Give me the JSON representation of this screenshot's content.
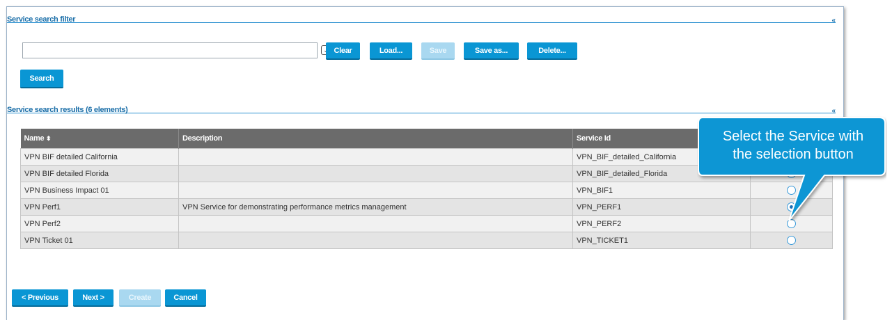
{
  "filter": {
    "section_title": "Service search filter",
    "collapse_label": "«",
    "input_value": "",
    "buttons": {
      "clear": "Clear",
      "load": "Load...",
      "save": "Save",
      "save_as": "Save as...",
      "delete": "Delete...",
      "search": "Search"
    }
  },
  "results": {
    "section_title": "Service search results (6 elements)",
    "collapse_label": "«",
    "columns": [
      "Name",
      "Description",
      "Service Id"
    ],
    "sort_indicator": "⬍",
    "rows": [
      {
        "name": "VPN BIF detailed California",
        "description": "",
        "service_id": "VPN_BIF_detailed_California",
        "selected": false
      },
      {
        "name": "VPN BIF detailed Florida",
        "description": "",
        "service_id": "VPN_BIF_detailed_Florida",
        "selected": false
      },
      {
        "name": "VPN Business Impact 01",
        "description": "",
        "service_id": "VPN_BIF1",
        "selected": false
      },
      {
        "name": "VPN Perf1",
        "description": "VPN Service for demonstrating performance metrics management",
        "service_id": "VPN_PERF1",
        "selected": true
      },
      {
        "name": "VPN Perf2",
        "description": "",
        "service_id": "VPN_PERF2",
        "selected": false
      },
      {
        "name": "VPN Ticket 01",
        "description": "",
        "service_id": "VPN_TICKET1",
        "selected": false
      }
    ]
  },
  "footer": {
    "previous": "< Previous",
    "next": "Next >",
    "create": "Create",
    "cancel": "Cancel"
  },
  "callout": {
    "line1": "Select the Service with",
    "line2": "the selection button"
  },
  "colors": {
    "accent": "#0a96d4",
    "header_text": "#1a6ea8",
    "table_header": "#6b6b6b",
    "callout": "#0a96d4"
  }
}
